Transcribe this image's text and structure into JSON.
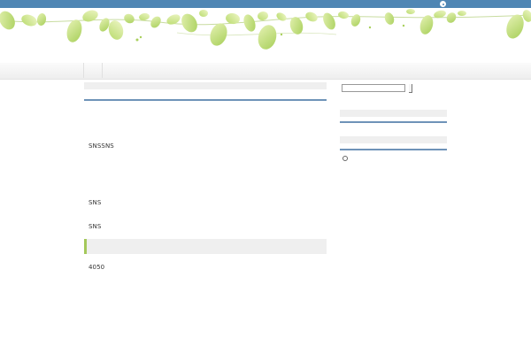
{
  "header": {
    "top_icon": "chevron-icon",
    "decoration": "leaf-garland"
  },
  "main": {
    "text_1": "SNSSNS",
    "text_2": "SNS",
    "text_3": "SNS",
    "text_4": "4050"
  },
  "sidebar": {
    "search_value": "",
    "widget_icon": "gear-icon"
  },
  "colors": {
    "top_bar": "#4f86b4",
    "rule": "#6e93b8",
    "leaf": "#a4c85a",
    "panel": "#efefef"
  }
}
